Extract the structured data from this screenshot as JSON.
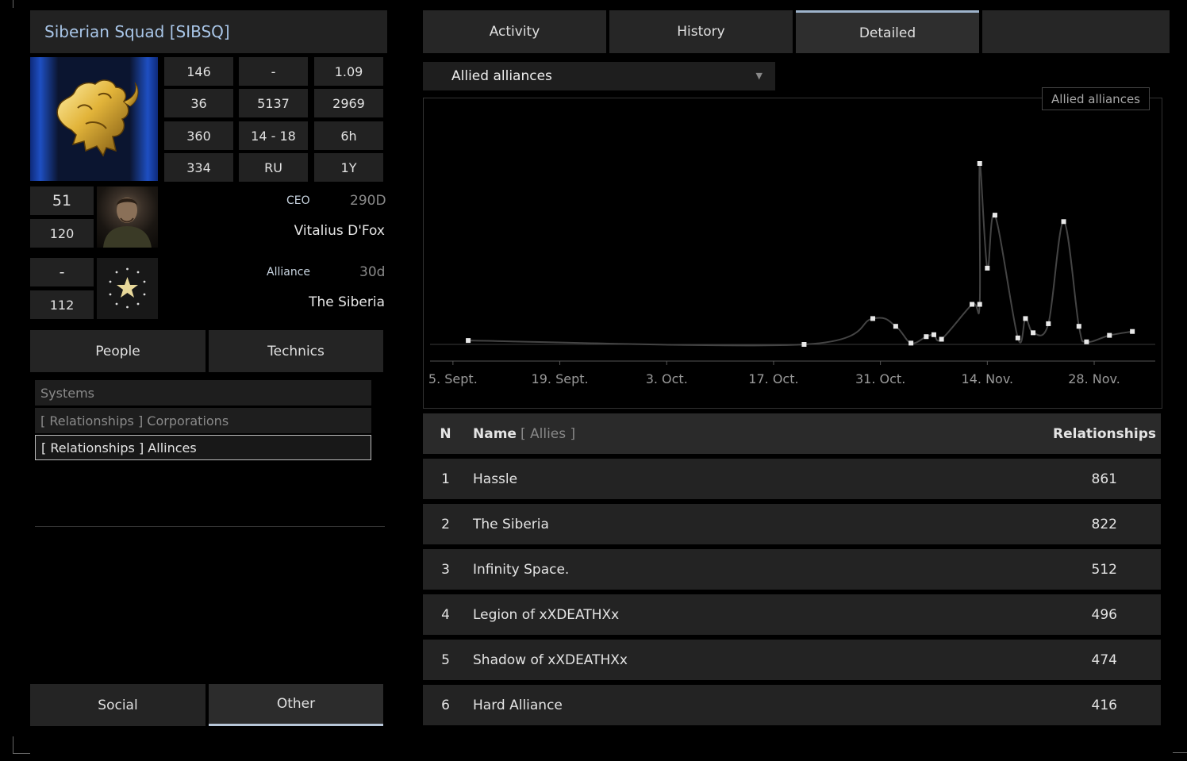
{
  "corp": {
    "title": "Siberian Squad [SIBSQ]",
    "stats": [
      [
        "146",
        "-",
        "1.09"
      ],
      [
        "36",
        "5137",
        "2969"
      ],
      [
        "360",
        "14 - 18",
        "6h"
      ],
      [
        "334",
        "RU",
        "1Y"
      ]
    ],
    "ceo_stats": [
      "51",
      "120"
    ],
    "alliance_stats": [
      "-",
      "112"
    ],
    "ceo": {
      "label": "CEO",
      "days": "290D",
      "name": "Vitalius D'Fox"
    },
    "alliance": {
      "label": "Alliance",
      "days": "30d",
      "name": "The Siberia"
    }
  },
  "left_tabs": {
    "people": "People",
    "technics": "Technics"
  },
  "left_list": [
    "Systems",
    "[ Relationships ] Corporations",
    "[ Relationships ] Allinces"
  ],
  "bottom_tabs": {
    "social": "Social",
    "other": "Other"
  },
  "top_tabs": [
    "Activity",
    "History",
    "Detailed",
    ""
  ],
  "dropdown": {
    "value": "Allied alliances",
    "arrow": "▼"
  },
  "chart_data": {
    "type": "line",
    "legend": "Allied alliances",
    "x_ticks": [
      "5. Sept.",
      "19. Sept.",
      "3. Oct.",
      "17. Oct.",
      "31. Oct.",
      "14. Nov.",
      "28. Nov."
    ],
    "series": [
      {
        "name": "Allied alliances",
        "points": [
          [
            "2023-09-07",
            6
          ],
          [
            "2023-10-21",
            0
          ],
          [
            "2023-10-30",
            40
          ],
          [
            "2023-11-02",
            28
          ],
          [
            "2023-11-04",
            2
          ],
          [
            "2023-11-06",
            12
          ],
          [
            "2023-11-07",
            15
          ],
          [
            "2023-11-08",
            8
          ],
          [
            "2023-11-13",
            62
          ],
          [
            "2023-11-12",
            62
          ],
          [
            "2023-11-13",
            280
          ],
          [
            "2023-11-14",
            118
          ],
          [
            "2023-11-15",
            200
          ],
          [
            "2023-11-18",
            10
          ],
          [
            "2023-11-19",
            40
          ],
          [
            "2023-11-20",
            18
          ],
          [
            "2023-11-22",
            32
          ],
          [
            "2023-11-24",
            190
          ],
          [
            "2023-11-26",
            28
          ],
          [
            "2023-11-27",
            4
          ],
          [
            "2023-11-30",
            14
          ],
          [
            "2023-12-03",
            20
          ]
        ]
      }
    ]
  },
  "table": {
    "headers": {
      "n": "N",
      "name": "Name",
      "name_sub": "[ Allies ]",
      "rel": "Relationships"
    },
    "rows": [
      {
        "n": "1",
        "name": "Hassle",
        "rel": "861"
      },
      {
        "n": "2",
        "name": "The Siberia",
        "rel": "822"
      },
      {
        "n": "3",
        "name": "Infinity Space.",
        "rel": "512"
      },
      {
        "n": "4",
        "name": "Legion of xXDEATHXx",
        "rel": "496"
      },
      {
        "n": "5",
        "name": "Shadow of xXDEATHXx",
        "rel": "474"
      },
      {
        "n": "6",
        "name": "Hard Alliance",
        "rel": "416"
      }
    ]
  }
}
